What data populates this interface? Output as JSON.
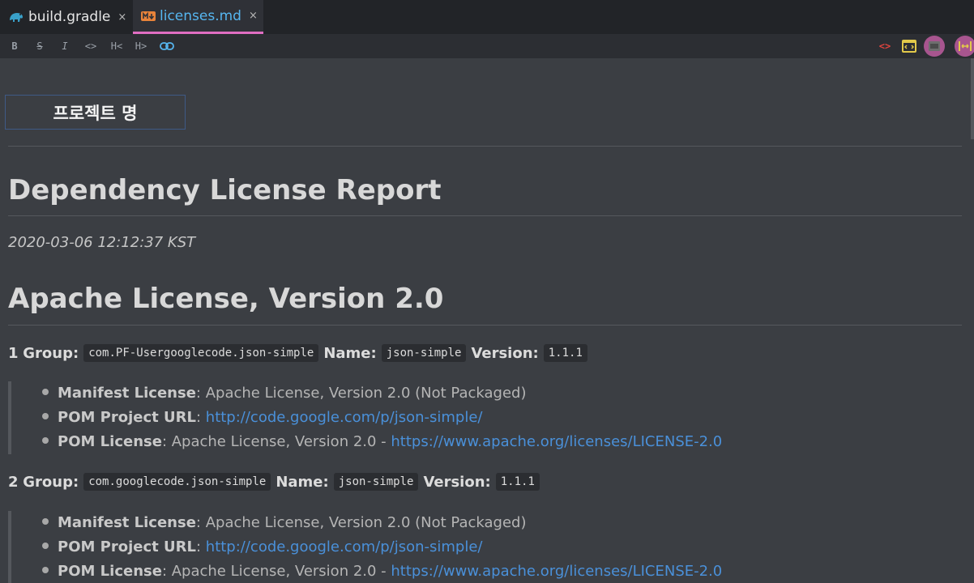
{
  "tabs": [
    {
      "label": "build.gradle",
      "icon": "gradle-elephant-icon",
      "close": "×"
    },
    {
      "label": "licenses.md",
      "icon": "markdown-icon",
      "close": "×"
    }
  ],
  "toolbar": {
    "left": [
      {
        "name": "bold-button",
        "label": "B"
      },
      {
        "name": "strikethrough-button",
        "label": "S"
      },
      {
        "name": "italic-button",
        "label": "I"
      },
      {
        "name": "code-button",
        "label": "<>"
      },
      {
        "name": "heading-decrease-button",
        "label": "H<"
      },
      {
        "name": "heading-increase-button",
        "label": "H>"
      },
      {
        "name": "link-button",
        "label": "link-icon"
      }
    ],
    "right": [
      {
        "name": "editor-only-button",
        "label": "<>",
        "color": "#e0443e"
      },
      {
        "name": "editor-preview-button",
        "label": "split-icon",
        "color": "#e2c94a"
      },
      {
        "name": "preview-only-button",
        "label": "preview-icon",
        "color": "#c65dc1"
      },
      {
        "name": "sync-scroll-button",
        "label": "|↔|",
        "color": "#c65dc1"
      }
    ]
  },
  "doc": {
    "project_title": "프로젝트 명",
    "report_title": "Dependency License Report",
    "timestamp": "2020-03-06 12:12:37 KST",
    "license_heading": "Apache License, Version 2.0",
    "entries": [
      {
        "index": "1",
        "group_label": "Group:",
        "group": "com.PF-Usergooglecode.json-simple",
        "name_label": "Name:",
        "name": "json-simple",
        "version_label": "Version:",
        "version": "1.1.1",
        "items": [
          {
            "label": "Manifest License",
            "sep": ": ",
            "text": "Apache License, Version 2.0 (Not Packaged)",
            "link": ""
          },
          {
            "label": "POM Project URL",
            "sep": ": ",
            "text": "",
            "link": "http://code.google.com/p/json-simple/"
          },
          {
            "label": "POM License",
            "sep": ": ",
            "text": "Apache License, Version 2.0 - ",
            "link": "https://www.apache.org/licenses/LICENSE-2.0"
          }
        ]
      },
      {
        "index": "2",
        "group_label": "Group:",
        "group": "com.googlecode.json-simple",
        "name_label": "Name:",
        "name": "json-simple",
        "version_label": "Version:",
        "version": "1.1.1",
        "items": [
          {
            "label": "Manifest License",
            "sep": ": ",
            "text": "Apache License, Version 2.0 (Not Packaged)",
            "link": ""
          },
          {
            "label": "POM Project URL",
            "sep": ": ",
            "text": "",
            "link": "http://code.google.com/p/json-simple/"
          },
          {
            "label": "POM License",
            "sep": ": ",
            "text": "Apache License, Version 2.0 - ",
            "link": "https://www.apache.org/licenses/LICENSE-2.0"
          }
        ]
      }
    ]
  },
  "colors": {
    "background": "#3b3e43",
    "tabbar": "#222428",
    "active_tab_underline": "#e06ec2",
    "link": "#4a90d9"
  }
}
